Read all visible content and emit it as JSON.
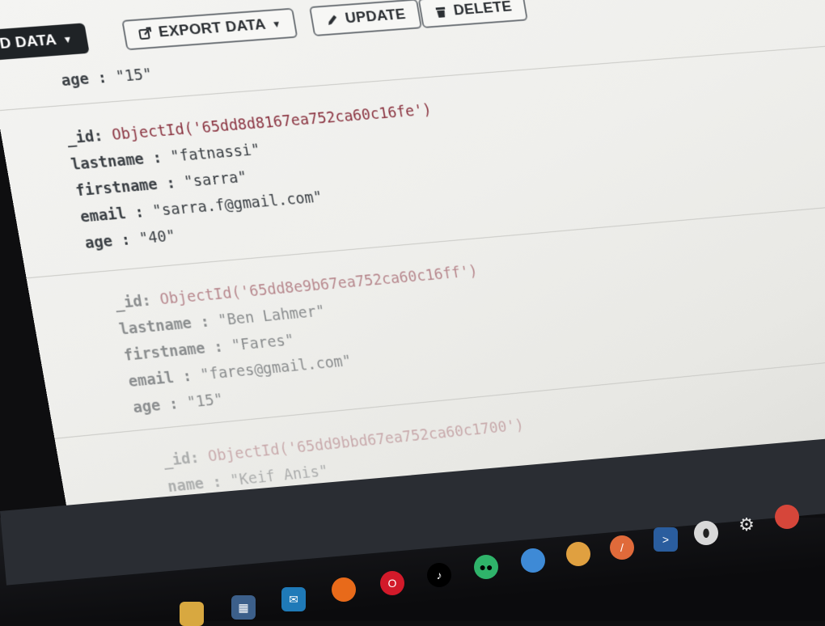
{
  "toolbar": {
    "add_data_label": "D DATA",
    "export_label": "EXPORT DATA",
    "update_label": "UPDATE",
    "delete_label": "DELETE"
  },
  "documents": [
    {
      "rows": [
        {
          "key": "age",
          "value": "\"15\""
        }
      ]
    },
    {
      "rows": [
        {
          "key": "_id",
          "value": "ObjectId('65dd8d8167ea752ca60c16fe')",
          "type": "oid"
        },
        {
          "key": "lastname",
          "value": "\"fatnassi\""
        },
        {
          "key": "firstname",
          "value": "\"sarra\""
        },
        {
          "key": "email",
          "value": "\"sarra.f@gmail.com\""
        },
        {
          "key": "age",
          "value": "\"40\""
        }
      ]
    },
    {
      "rows": [
        {
          "key": "_id",
          "value": "ObjectId('65dd8e9b67ea752ca60c16ff')",
          "type": "oid"
        },
        {
          "key": "lastname",
          "value": "\"Ben Lahmer\""
        },
        {
          "key": "firstname",
          "value": "\"Fares\""
        },
        {
          "key": "email",
          "value": "\"fares@gmail.com\""
        },
        {
          "key": "age",
          "value": "\"15\""
        }
      ]
    },
    {
      "rows": [
        {
          "key": "_id",
          "value": "ObjectId('65dd9bbd67ea752ca60c1700')",
          "type": "oid"
        },
        {
          "key": "name",
          "value": "\"Keif Anis\""
        }
      ]
    }
  ],
  "taskbar_icons": [
    "file-explorer-icon",
    "store-icon",
    "mail-icon",
    "firefox-icon",
    "opera-icon",
    "tiktok-icon",
    "tripadvisor-icon",
    "spinner-app-icon",
    "medal-icon",
    "compass-icon",
    "powershell-icon",
    "mongodb-compass-icon",
    "settings-icon",
    "chrome-icon"
  ],
  "colors": {
    "oid": "#8a3340",
    "toolbar_dark": "#1f2326",
    "taskbar": "#1c1d21"
  }
}
